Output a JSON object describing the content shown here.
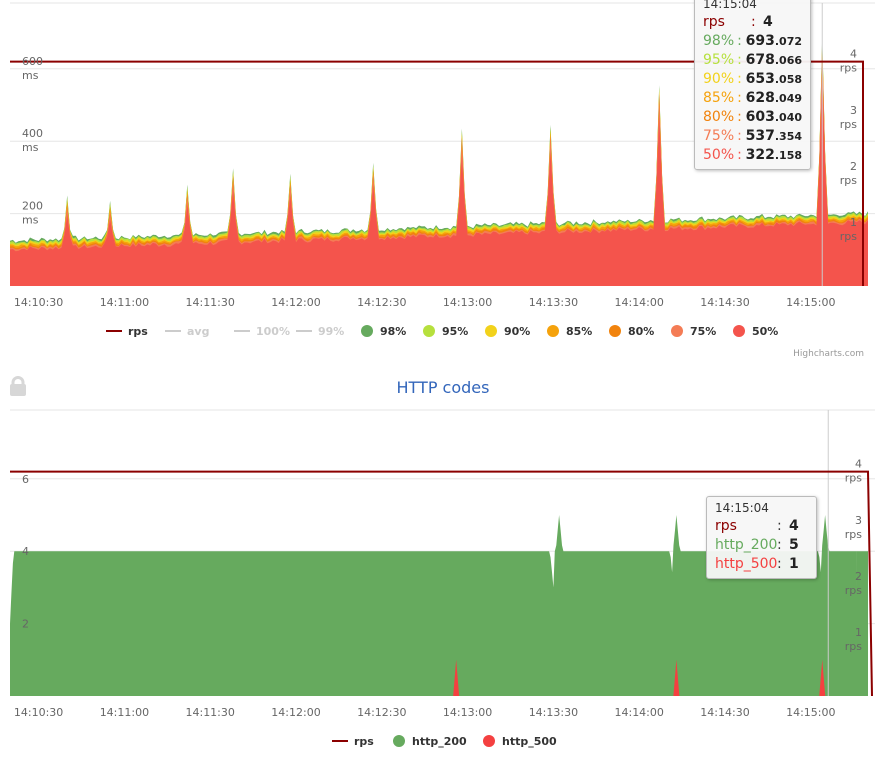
{
  "chart_data": [
    {
      "type": "area",
      "title": "",
      "x_axis": {
        "type": "datetime",
        "tick_labels": [
          "14:10:30",
          "14:11:00",
          "14:11:30",
          "14:12:00",
          "14:12:30",
          "14:13:00",
          "14:13:30",
          "14:14:00",
          "14:14:30",
          "14:15:00"
        ],
        "range": [
          "14:10:20",
          "14:15:20"
        ]
      },
      "y_axis_left": {
        "ticks": [
          200,
          400,
          600
        ],
        "unit": "ms",
        "range": [
          0,
          790
        ]
      },
      "y_axis_right": {
        "ticks": [
          1,
          2,
          3,
          4
        ],
        "unit": "rps",
        "range": [
          0,
          5.1
        ]
      },
      "grid": true,
      "legend_placement": "bottom-center",
      "legend": [
        {
          "name": "rps",
          "color": "#8b0000",
          "symbol": "line",
          "enabled": true
        },
        {
          "name": "avg",
          "color": "#cccccc",
          "symbol": "line",
          "enabled": false
        },
        {
          "name": "100%",
          "color": "#cccccc",
          "symbol": "line",
          "enabled": false
        },
        {
          "name": "99%",
          "color": "#cccccc",
          "symbol": "line",
          "enabled": false
        },
        {
          "name": "98%",
          "color": "#66aa5e",
          "symbol": "circle",
          "enabled": true
        },
        {
          "name": "95%",
          "color": "#b6e03d",
          "symbol": "circle",
          "enabled": true
        },
        {
          "name": "90%",
          "color": "#f2d21b",
          "symbol": "circle",
          "enabled": true
        },
        {
          "name": "85%",
          "color": "#f5a20c",
          "symbol": "circle",
          "enabled": true
        },
        {
          "name": "80%",
          "color": "#f1830d",
          "symbol": "circle",
          "enabled": true
        },
        {
          "name": "75%",
          "color": "#f47c55",
          "symbol": "circle",
          "enabled": true
        },
        {
          "name": "50%",
          "color": "#f4544c",
          "symbol": "circle",
          "enabled": true
        }
      ],
      "series_summary": {
        "rps": {
          "value": 4,
          "note": "constant until ~14:15:20 then drops to 0"
        },
        "quantiles_ms_typical": {
          "50%": 105,
          "75%": 115,
          "80%": 120,
          "85%": 125,
          "90%": 130,
          "95%": 135,
          "98%": 140
        },
        "trend": "50% rises slowly from ~100 ms to ~180 ms; periodic spikes up to ~450–650 ms"
      },
      "spikes": [
        {
          "time": "14:10:40",
          "ms": 250
        },
        {
          "time": "14:10:55",
          "ms": 235
        },
        {
          "time": "14:11:22",
          "ms": 280
        },
        {
          "time": "14:11:38",
          "ms": 325
        },
        {
          "time": "14:11:58",
          "ms": 310
        },
        {
          "time": "14:12:27",
          "ms": 340
        },
        {
          "time": "14:12:58",
          "ms": 435
        },
        {
          "time": "14:13:29",
          "ms": 445
        },
        {
          "time": "14:14:07",
          "ms": 555
        },
        {
          "time": "14:15:04",
          "ms": 693
        }
      ],
      "tooltip": {
        "time": "14:15:04",
        "rows": [
          {
            "label": "rps",
            "value_int": "4",
            "value_dec": "",
            "color": "#8b0000"
          },
          {
            "label": "98%",
            "value_int": "693",
            "value_dec": ".072",
            "color": "#66aa5e"
          },
          {
            "label": "95%",
            "value_int": "678",
            "value_dec": ".066",
            "color": "#b6e03d"
          },
          {
            "label": "90%",
            "value_int": "653",
            "value_dec": ".058",
            "color": "#f2d21b"
          },
          {
            "label": "85%",
            "value_int": "628",
            "value_dec": ".049",
            "color": "#f5a20c"
          },
          {
            "label": "80%",
            "value_int": "603",
            "value_dec": ".040",
            "color": "#f1830d"
          },
          {
            "label": "75%",
            "value_int": "537",
            "value_dec": ".354",
            "color": "#f47c55"
          },
          {
            "label": "50%",
            "value_int": "322",
            "value_dec": ".158",
            "color": "#f4544c"
          }
        ]
      }
    },
    {
      "type": "area",
      "title": "HTTP codes",
      "x_axis": {
        "type": "datetime",
        "tick_labels": [
          "14:10:30",
          "14:11:00",
          "14:11:30",
          "14:12:00",
          "14:12:30",
          "14:13:00",
          "14:13:30",
          "14:14:00",
          "14:14:30",
          "14:15:00"
        ],
        "range": [
          "14:10:20",
          "14:15:20"
        ]
      },
      "y_axis_left": {
        "ticks": [
          2,
          4,
          6
        ],
        "range": [
          0,
          7.9
        ]
      },
      "y_axis_right": {
        "ticks": [
          1,
          2,
          3,
          4
        ],
        "unit": "rps",
        "range": [
          0,
          5.1
        ]
      },
      "grid": true,
      "legend_placement": "bottom-center",
      "legend": [
        {
          "name": "rps",
          "color": "#8b0000",
          "symbol": "line"
        },
        {
          "name": "http_200",
          "color": "#66aa5e",
          "symbol": "circle"
        },
        {
          "name": "http_500",
          "color": "#f44040",
          "symbol": "circle"
        }
      ],
      "series_summary": {
        "rps": {
          "value": 4
        },
        "http_200": {
          "value": 4,
          "dips_to_3_at": [
            "14:13:30",
            "14:14:12",
            "14:15:04"
          ],
          "peaks_to_5_at": [
            "14:13:32",
            "14:14:13",
            "14:15:05"
          ]
        },
        "http_500": {
          "value": 0,
          "spikes_to_1_at": [
            "14:12:56",
            "14:14:13",
            "14:15:04"
          ]
        }
      },
      "tooltip": {
        "time": "14:15:04",
        "rows": [
          {
            "label": "rps",
            "value": "4",
            "color": "#8b0000"
          },
          {
            "label": "http_200",
            "value": "5",
            "color": "#66aa5e"
          },
          {
            "label": "http_500",
            "value": "1",
            "color": "#f44040"
          }
        ]
      }
    }
  ],
  "labels": {
    "ms_unit": "ms",
    "rps_unit": "rps",
    "credits": "Highcharts.com",
    "chart2_title": "HTTP codes",
    "lock_icon": "lock-icon"
  }
}
